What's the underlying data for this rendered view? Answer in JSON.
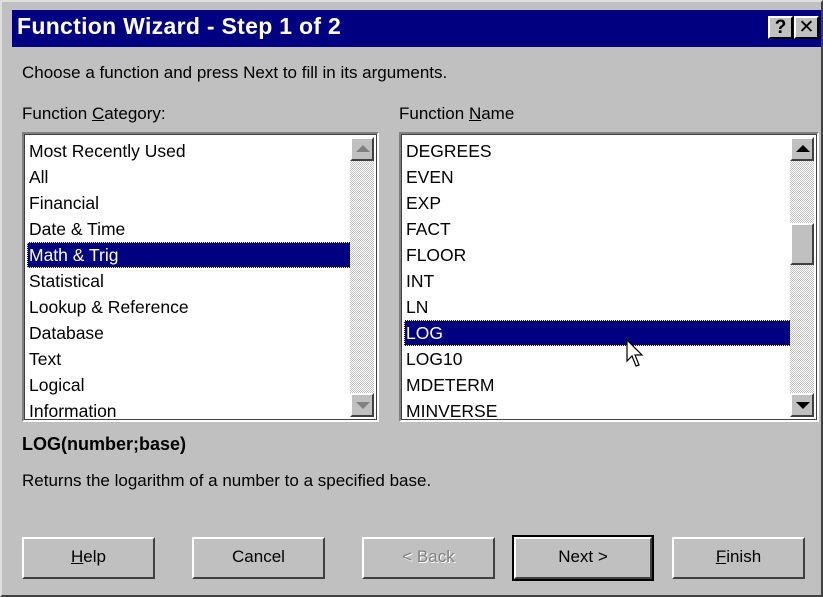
{
  "window": {
    "title": "Function Wizard - Step 1 of 2",
    "help_glyph": "?",
    "close_glyph": "✕"
  },
  "instruction": "Choose a function and press Next to fill in its arguments.",
  "category": {
    "label_pre": "Function ",
    "label_accel": "C",
    "label_post": "ategory:",
    "items": [
      "Most Recently Used",
      "All",
      "Financial",
      "Date & Time",
      "Math & Trig",
      "Statistical",
      "Lookup & Reference",
      "Database",
      "Text",
      "Logical",
      "Information"
    ],
    "selected": "Math & Trig"
  },
  "name": {
    "label_pre": "Function ",
    "label_accel": "N",
    "label_post": "ame",
    "items": [
      "DEGREES",
      "EVEN",
      "EXP",
      "FACT",
      "FLOOR",
      "INT",
      "LN",
      "LOG",
      "LOG10",
      "MDETERM",
      "MINVERSE"
    ],
    "selected": "LOG"
  },
  "syntax": "LOG(number;base)",
  "description": "Returns the logarithm of a number to a specified base.",
  "buttons": {
    "help_accel": "H",
    "help_rest": "elp",
    "cancel": "Cancel",
    "back": "< Back",
    "next": "Next >",
    "finish_accel": "F",
    "finish_rest": "inish"
  },
  "icons": {
    "help": "question-mark-icon",
    "close": "close-icon",
    "cursor": "mouse-pointer-icon"
  },
  "colors": {
    "titlebar": "#000080",
    "selection": "#000080",
    "face": "#c0c0c0"
  }
}
